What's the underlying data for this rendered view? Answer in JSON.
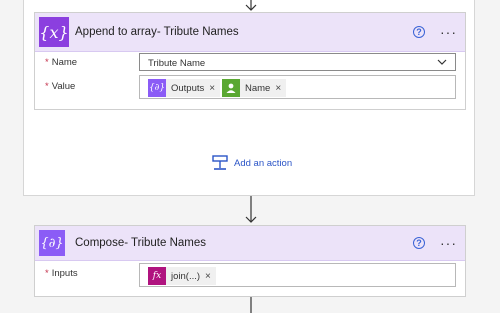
{
  "append_card": {
    "title": "Append to array- Tribute Names",
    "icon_symbol": "{x}",
    "icon_color": "#8b3fdf",
    "name_label": "Name",
    "name_value": "Tribute Name",
    "value_label": "Value",
    "value_tokens": [
      {
        "label": "Outputs",
        "icon": "compose-token-icon",
        "color": "#8b5cf6"
      },
      {
        "label": "Name",
        "icon": "user-token-icon",
        "color": "#5aa832"
      }
    ]
  },
  "add_action": {
    "label": "Add an action"
  },
  "compose_card": {
    "title": "Compose- Tribute Names",
    "icon_symbol": "{∂}",
    "icon_color": "#8b5cf6",
    "inputs_label": "Inputs",
    "inputs_token": {
      "label": "join(...)",
      "icon": "fx",
      "color": "#b0137f"
    }
  },
  "common": {
    "required_mark": "*",
    "help_symbol": "?",
    "more_symbol": "···",
    "remove_symbol": "×"
  }
}
